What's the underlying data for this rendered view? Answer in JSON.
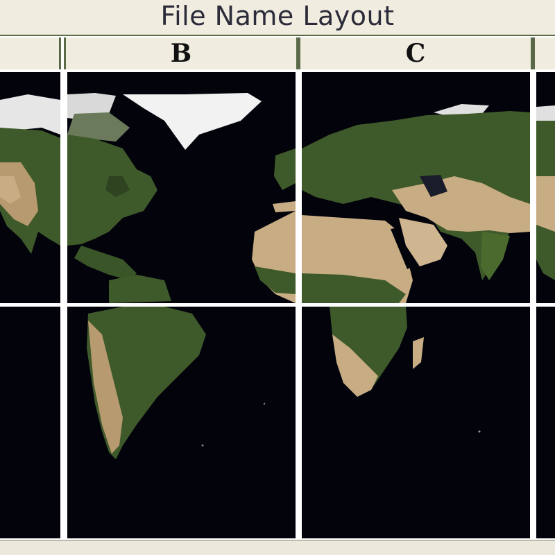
{
  "title": "File Name Layout",
  "columns": [
    {
      "letter": ""
    },
    {
      "letter": "B"
    },
    {
      "letter": "C"
    },
    {
      "letter": ""
    }
  ],
  "colors": {
    "ocean": "#03030c",
    "land_green": "#3f5a2a",
    "desert": "#c8ad84",
    "ice": "#f2f2f2",
    "header_bg": "#f0ece0",
    "header_border": "#5a6a48"
  }
}
